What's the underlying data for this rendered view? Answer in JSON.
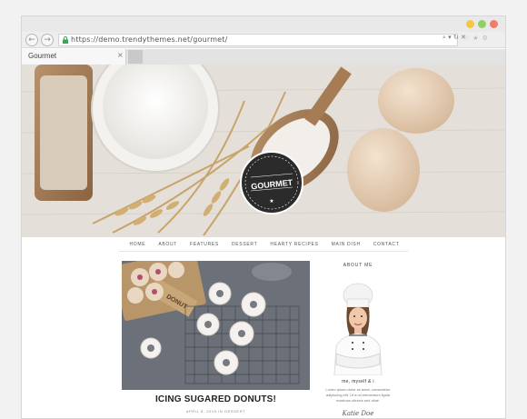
{
  "browser": {
    "url": "https://demo.trendythemes.net/gourmet/",
    "url_tools": "⌕ ▾ ↻ ✕",
    "right_tools": [
      "☆",
      "★",
      "⚙"
    ],
    "tab_title": "Gourmet",
    "tab_close": "×",
    "back_icon": "←",
    "forward_icon": "→",
    "window_dot_colors": [
      "#f1c83f",
      "#8fcf64",
      "#f27c6c"
    ]
  },
  "site": {
    "logo_text": "GOURMET",
    "nav": [
      "HOME",
      "ABOUT",
      "FEATURES",
      "DESSERT",
      "HEARTY RECIPES",
      "MAIN DISH",
      "CONTACT"
    ]
  },
  "post": {
    "title": "ICING SUGARED DONUTS!",
    "meta": "APRIL 8, 2015 IN DESSERT",
    "box_label": "DONUT"
  },
  "sidebar": {
    "widget_title": "ABOUT ME",
    "name": "me, myself & i",
    "text": "Lorem ipsum dolor sit amet, consectetur adipiscing elit. Ut a mi elementum ligula maximus ultrices sed vitae.",
    "signature": "Katie Doe"
  }
}
